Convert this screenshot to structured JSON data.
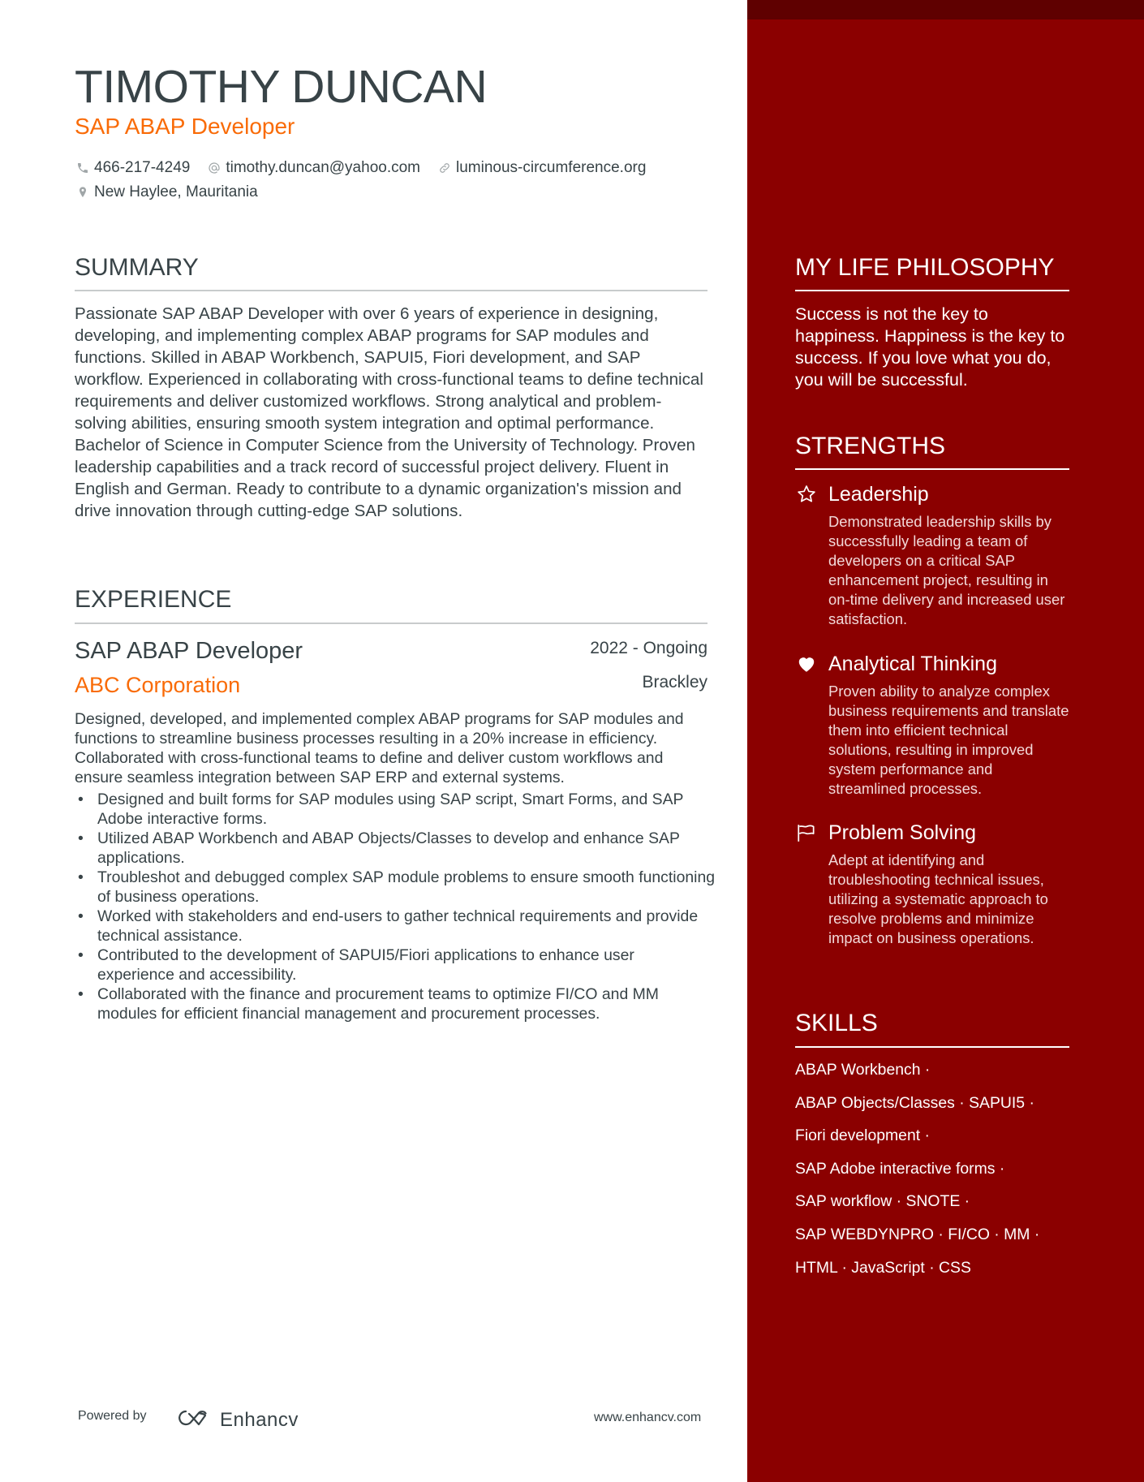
{
  "header": {
    "name": "TIMOTHY DUNCAN",
    "title": "SAP ABAP Developer",
    "contacts": {
      "phone": "466-217-4249",
      "email": "timothy.duncan@yahoo.com",
      "website": "luminous-circumference.org",
      "location": "New Haylee, Mauritania"
    }
  },
  "summary": {
    "heading": "SUMMARY",
    "text": "Passionate SAP ABAP Developer with over 6 years of experience in designing, developing, and implementing complex ABAP programs for SAP modules and functions. Skilled in ABAP Workbench, SAPUI5, Fiori development, and SAP workflow. Experienced in collaborating with cross-functional teams to define technical requirements and deliver customized workflows. Strong analytical and problem-solving abilities, ensuring smooth system integration and optimal performance. Bachelor of Science in Computer Science from the University of Technology. Proven leadership capabilities and a track record of successful project delivery. Fluent in English and German. Ready to contribute to a dynamic organization's mission and drive innovation through cutting-edge SAP solutions."
  },
  "experience": {
    "heading": "EXPERIENCE",
    "items": [
      {
        "role": "SAP ABAP Developer",
        "dates": "2022 - Ongoing",
        "company": "ABC Corporation",
        "location": "Brackley",
        "description": "Designed, developed, and implemented complex ABAP programs for SAP modules and functions to streamline business processes resulting in a 20% increase in efficiency. Collaborated with cross-functional teams to define and deliver custom workflows and ensure seamless integration between SAP ERP and external systems.",
        "bullets": [
          "Designed and built forms for SAP modules using SAP script, Smart Forms, and SAP Adobe interactive forms.",
          "Utilized ABAP Workbench and ABAP Objects/Classes to develop and enhance SAP applications.",
          "Troubleshot and debugged complex SAP module problems to ensure smooth functioning of business operations.",
          "Worked with stakeholders and end-users to gather technical requirements and provide technical assistance.",
          "Contributed to the development of SAPUI5/Fiori applications to enhance user experience and accessibility.",
          "Collaborated with the finance and procurement teams to optimize FI/CO and MM modules for efficient financial management and procurement processes."
        ]
      }
    ]
  },
  "sidebar": {
    "philosophy": {
      "heading": "MY LIFE PHILOSOPHY",
      "text": "Success is not the key to happiness. Happiness is the key to success. If you love what you do, you will be successful."
    },
    "strengths": {
      "heading": "STRENGTHS",
      "items": [
        {
          "icon": "star-icon",
          "name": "Leadership",
          "description": "Demonstrated leadership skills by successfully leading a team of developers on a critical SAP enhancement project, resulting in on-time delivery and increased user satisfaction."
        },
        {
          "icon": "heart-icon",
          "name": "Analytical Thinking",
          "description": "Proven ability to analyze complex business requirements and translate them into efficient technical solutions, resulting in improved system performance and streamlined processes."
        },
        {
          "icon": "flag-icon",
          "name": "Problem Solving",
          "description": "Adept at identifying and troubleshooting technical issues, utilizing a systematic approach to resolve problems and minimize impact on business operations."
        }
      ]
    },
    "skills": {
      "heading": "SKILLS",
      "lines": [
        "ABAP Workbench ·",
        "ABAP Objects/Classes · SAPUI5 ·",
        "Fiori development ·",
        "SAP Adobe interactive forms ·",
        "SAP workflow · SNOTE ·",
        "SAP WEBDYNPRO · FI/CO · MM ·",
        "HTML · JavaScript · CSS"
      ]
    }
  },
  "footer": {
    "powered_by": "Powered by",
    "brand": "Enhancv",
    "url": "www.enhancv.com"
  },
  "colors": {
    "accent": "#f96b07",
    "text": "#384347",
    "sidebar": "#8b0000",
    "sidebar_band": "#5f0000"
  }
}
